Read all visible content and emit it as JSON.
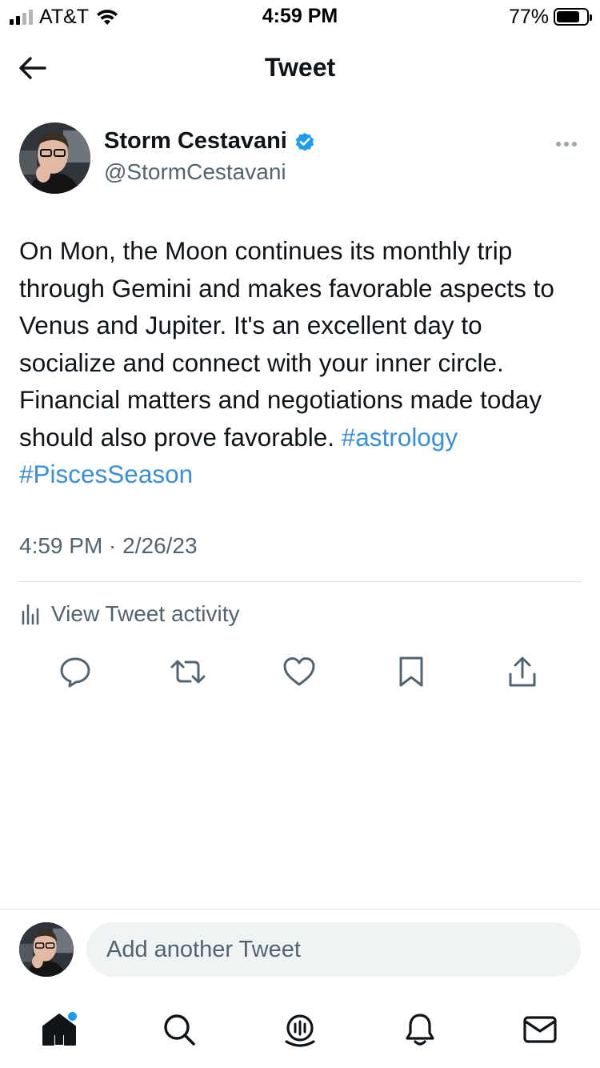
{
  "status_bar": {
    "carrier": "AT&T",
    "time": "4:59 PM",
    "battery_percent": "77%",
    "battery_level": 0.77,
    "signal_bars": 2
  },
  "header": {
    "title": "Tweet",
    "back_icon": "arrow-left-icon"
  },
  "tweet": {
    "author_name": "Storm Cestavani",
    "author_handle": "@StormCestavani",
    "verified": true,
    "text": "On Mon, the Moon continues its monthly trip through Gemini and makes favorable aspects to Venus and Jupiter. It's an excellent day to socialize and connect with your inner circle. Financial matters and negotiations made today should also prove favorable.",
    "hashtags": [
      "#astrology",
      "#PiscesSeason"
    ],
    "timestamp": "4:59 PM · 2/26/23",
    "activity_label": "View Tweet activity"
  },
  "actions": [
    {
      "name": "reply-icon"
    },
    {
      "name": "retweet-icon"
    },
    {
      "name": "like-icon"
    },
    {
      "name": "bookmark-icon"
    },
    {
      "name": "share-icon"
    }
  ],
  "composer": {
    "placeholder": "Add another Tweet"
  },
  "tabbar": [
    {
      "name": "home-icon",
      "badge": true
    },
    {
      "name": "search-icon"
    },
    {
      "name": "spaces-icon"
    },
    {
      "name": "notifications-icon"
    },
    {
      "name": "messages-icon"
    }
  ],
  "colors": {
    "link": "#3b8fd6",
    "secondary_text": "#536471",
    "verified": "#1d9bf0"
  }
}
